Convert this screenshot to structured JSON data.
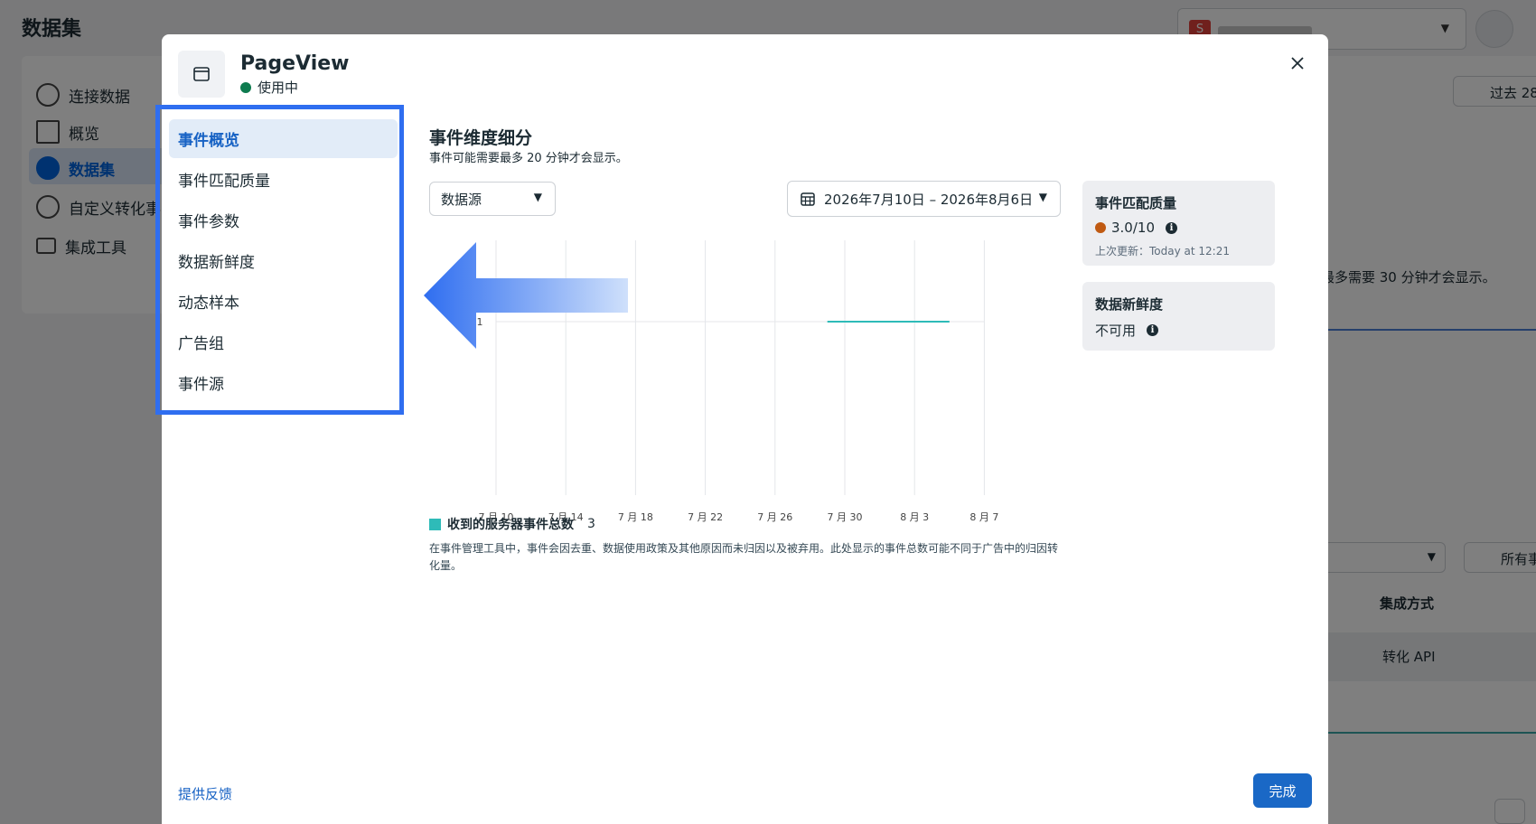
{
  "background": {
    "title": "数据集",
    "account_badge": "S",
    "nav": [
      {
        "label": "连接数据",
        "icon": "plus-circle-icon"
      },
      {
        "label": "概览",
        "icon": "layout-icon"
      },
      {
        "label": "数据集",
        "icon": "dataset-icon"
      },
      {
        "label": "自定义转化事",
        "icon": "star-circle-icon"
      },
      {
        "label": "集成工具",
        "icon": "integration-icon"
      }
    ],
    "range_button": "过去 28",
    "notice_text": "最多需要 30 分钟才会显示。",
    "filter_button": "所有事",
    "column_header": "集成方式",
    "row_value": "转化 API"
  },
  "modal": {
    "event_name": "PageView",
    "status": "使用中",
    "status_color": "#0e7b4f",
    "menu": [
      {
        "label": "事件概览",
        "active": true
      },
      {
        "label": "事件匹配质量",
        "active": false
      },
      {
        "label": "事件参数",
        "active": false
      },
      {
        "label": "数据新鲜度",
        "active": false
      },
      {
        "label": "动态样本",
        "active": false
      },
      {
        "label": "广告组",
        "active": false
      },
      {
        "label": "事件源",
        "active": false
      }
    ],
    "section_title": "事件维度细分",
    "section_subtitle": "事件可能需要最多 20 分钟才会显示。",
    "source_select": "数据源",
    "date_range": "2026年7月10日 – 2026年8月6日",
    "legend_label": "收到的服务器事件总数",
    "legend_count": "3",
    "note": "在事件管理工具中，事件会因去重、数据使用政策及其他原因而未归因以及被弃用。此处显示的事件总数可能不同于广告中的归因转化量。",
    "cards": {
      "quality": {
        "title": "事件匹配质量",
        "value": "3.0/10",
        "meta": "上次更新：Today at 12:21",
        "dot_color": "#c05a12"
      },
      "freshness": {
        "title": "数据新鲜度",
        "value": "不可用"
      }
    },
    "feedback": "提供反馈",
    "done": "完成"
  },
  "chart_data": {
    "type": "line",
    "x_ticks": [
      "7 月 10",
      "7 月 14",
      "7 月 18",
      "7 月 22",
      "7 月 26",
      "7 月 30",
      "8 月 3",
      "8 月 7"
    ],
    "y_ticks": [
      "1"
    ],
    "series": [
      {
        "name": "收到的服务器事件总数",
        "color": "#2ebbb8",
        "x_range": [
          "7 月 29",
          "8 月 5"
        ],
        "value": 1
      }
    ],
    "grid": true
  }
}
